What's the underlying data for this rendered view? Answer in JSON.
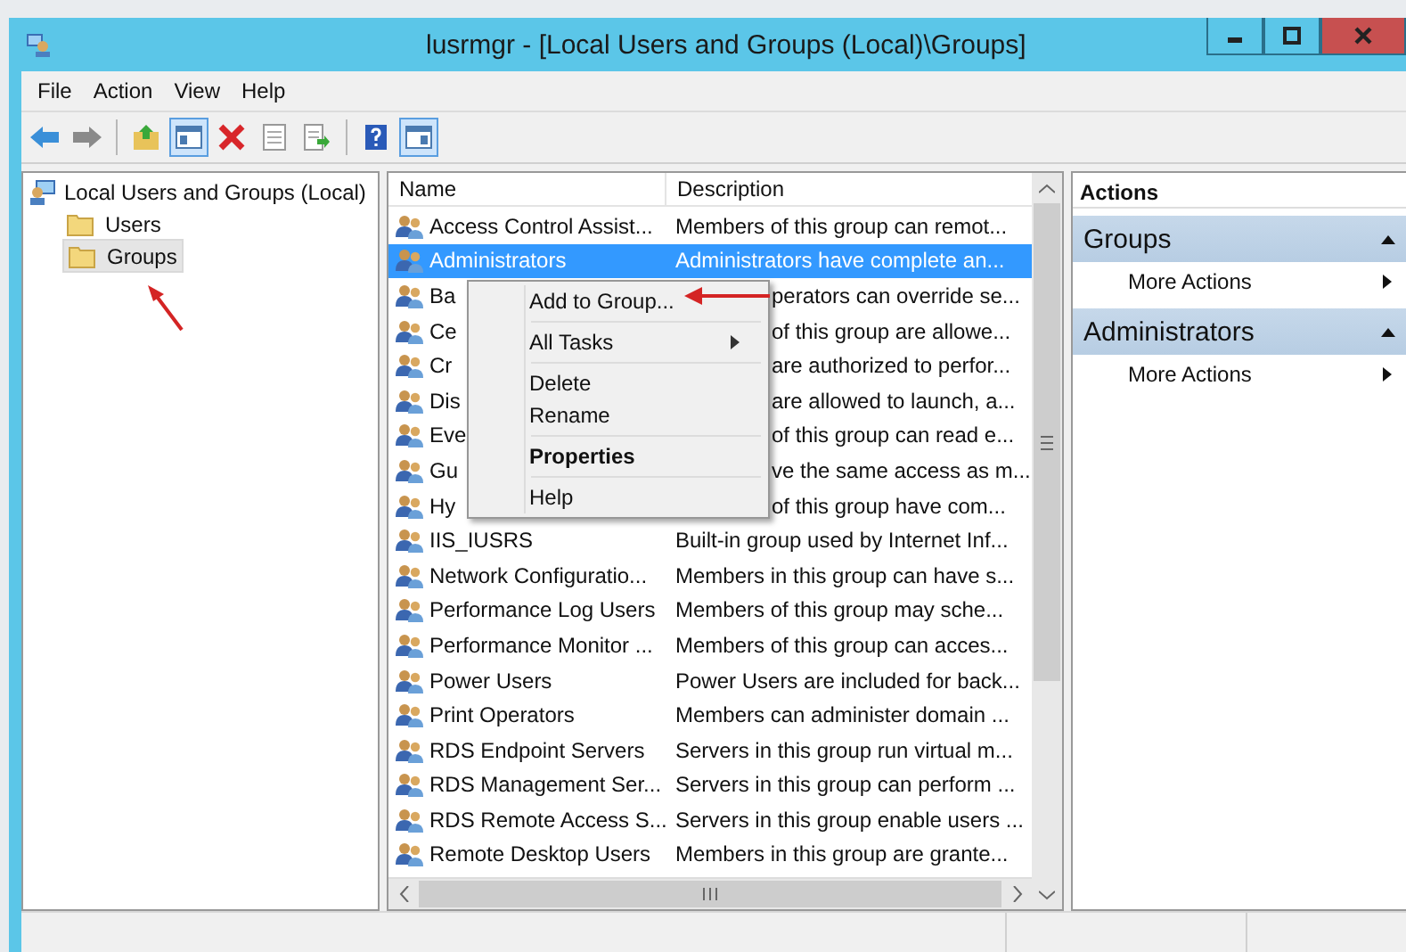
{
  "window": {
    "title": "lusrmgr - [Local Users and Groups (Local)\\Groups]"
  },
  "menu": [
    "File",
    "Action",
    "View",
    "Help"
  ],
  "toolbar": [
    {
      "kind": "back",
      "pressed": false
    },
    {
      "kind": "forward",
      "pressed": false
    },
    {
      "kind": "separator"
    },
    {
      "kind": "up",
      "pressed": false
    },
    {
      "kind": "tree",
      "pressed": true
    },
    {
      "kind": "delete",
      "pressed": false
    },
    {
      "kind": "properties",
      "pressed": false
    },
    {
      "kind": "export",
      "pressed": false
    },
    {
      "kind": "separator"
    },
    {
      "kind": "help",
      "pressed": false
    },
    {
      "kind": "actionpane",
      "pressed": true
    }
  ],
  "tree": {
    "label": "Local Users and Groups (Local)",
    "children": [
      {
        "label": "Users",
        "selected": false
      },
      {
        "label": "Groups",
        "selected": true
      }
    ]
  },
  "list": {
    "columns": [
      "Name",
      "Description"
    ],
    "rows": [
      {
        "kind": "full",
        "name": "Access Control Assist...",
        "description": "Members of this group can remot...",
        "selected": false
      },
      {
        "kind": "full",
        "name": "Administrators",
        "description": "Administrators have complete an...",
        "selected": true
      },
      {
        "kind": "partial",
        "name": "Ba",
        "description": "perators can override se...",
        "selected": false
      },
      {
        "kind": "partial",
        "name": "Ce",
        "description": "of this group are allowe...",
        "selected": false
      },
      {
        "kind": "partial",
        "name": "Cr",
        "description": "are authorized to perfor...",
        "selected": false
      },
      {
        "kind": "partial",
        "name": "Dis",
        "description": "are allowed to launch, a...",
        "selected": false
      },
      {
        "kind": "partial",
        "name": "Eve",
        "description": "of this group can read e...",
        "selected": false
      },
      {
        "kind": "partial",
        "name": "Gu",
        "description": "ve the same access as m...",
        "selected": false
      },
      {
        "kind": "partial",
        "name": "Hy",
        "description": "of this group have com...",
        "selected": false
      },
      {
        "kind": "full",
        "name": "IIS_IUSRS",
        "description": "Built-in group used by Internet Inf...",
        "selected": false
      },
      {
        "kind": "full",
        "name": "Network Configuratio...",
        "description": "Members in this group can have s...",
        "selected": false
      },
      {
        "kind": "full",
        "name": "Performance Log Users",
        "description": "Members of this group may sche...",
        "selected": false
      },
      {
        "kind": "full",
        "name": "Performance Monitor ...",
        "description": "Members of this group can acces...",
        "selected": false
      },
      {
        "kind": "full",
        "name": "Power Users",
        "description": "Power Users are included for back...",
        "selected": false
      },
      {
        "kind": "full",
        "name": "Print Operators",
        "description": "Members can administer domain ...",
        "selected": false
      },
      {
        "kind": "full",
        "name": "RDS Endpoint Servers",
        "description": "Servers in this group run virtual m...",
        "selected": false
      },
      {
        "kind": "full",
        "name": "RDS Management Ser...",
        "description": "Servers in this group can perform ...",
        "selected": false
      },
      {
        "kind": "full",
        "name": "RDS Remote Access S...",
        "description": "Servers in this group enable users ...",
        "selected": false
      },
      {
        "kind": "full",
        "name": "Remote Desktop Users",
        "description": "Members in this group are grante...",
        "selected": false
      }
    ]
  },
  "context_menu": {
    "items": [
      {
        "kind": "item",
        "label": "Add to Group...",
        "default": false
      },
      {
        "kind": "separator"
      },
      {
        "kind": "submenu",
        "label": "All Tasks",
        "default": false
      },
      {
        "kind": "separator"
      },
      {
        "kind": "item",
        "label": "Delete",
        "default": false
      },
      {
        "kind": "item",
        "label": "Rename",
        "default": false
      },
      {
        "kind": "separator"
      },
      {
        "kind": "item",
        "label": "Properties",
        "default": true
      },
      {
        "kind": "separator"
      },
      {
        "kind": "item",
        "label": "Help",
        "default": false
      }
    ]
  },
  "actions": {
    "title": "Actions",
    "sections": [
      {
        "title": "Groups",
        "items": [
          "More Actions"
        ]
      },
      {
        "title": "Administrators",
        "items": [
          "More Actions"
        ]
      }
    ]
  }
}
